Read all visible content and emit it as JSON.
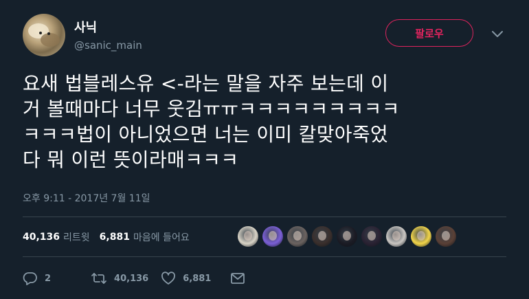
{
  "user": {
    "display_name": "사닉",
    "handle": "@sanic_main"
  },
  "follow_button": {
    "label": "팔로우"
  },
  "tweet": {
    "text": "요새 법블레스유 <-라는 말을 자주 보는데 이\n거 볼때마다 너무 웃김ㅠㅠㅋㅋㅋㅋㅋㅋㅋㅋㅋ\nㅋㅋㅋ법이 아니었으면 너는 이미 칼맞아죽었\n다 뭐 이런 뜻이라매ㅋㅋㅋ",
    "timestamp": "오후 9:11 - 2017년 7월 11일"
  },
  "stats": {
    "retweets_count": "40,136",
    "retweets_label": "리트윗",
    "likes_count": "6,881",
    "likes_label": "마음에 들어요"
  },
  "likers": [
    {
      "icon": "avatar-dog",
      "color": "#d9d4c7"
    },
    {
      "icon": "avatar-purple-orb",
      "color": "#7b5fd6"
    },
    {
      "icon": "avatar-person",
      "color": "#6b6360"
    },
    {
      "icon": "avatar-person",
      "color": "#3a2f2c"
    },
    {
      "icon": "avatar-person",
      "color": "#1b1b24"
    },
    {
      "icon": "avatar-person",
      "color": "#2a2233"
    },
    {
      "icon": "avatar-character",
      "color": "#c9c6c2"
    },
    {
      "icon": "avatar-pikachu",
      "color": "#f2d54a"
    },
    {
      "icon": "avatar-person",
      "color": "#5a4036"
    }
  ],
  "actions": {
    "reply_count": "2",
    "retweet_count": "40,136",
    "like_count": "6,881"
  },
  "colors": {
    "background": "#15202b",
    "text": "#ffffff",
    "muted": "#8899a6",
    "accent": "#e0245e",
    "divider": "#38444d"
  }
}
